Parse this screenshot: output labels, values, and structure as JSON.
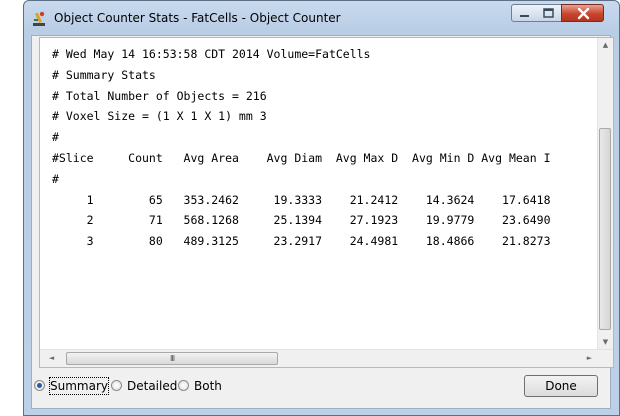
{
  "window": {
    "title": "Object Counter Stats - FatCells - Object Counter"
  },
  "icons": {
    "app": "imagej-microscope-icon",
    "minimize": "minimize-icon",
    "maximize": "maximize-icon",
    "close": "close-icon"
  },
  "stats_text": {
    "lines": [
      "# Wed May 14 16:53:58 CDT 2014 Volume=FatCells",
      "# Summary Stats",
      "# Total Number of Objects = 216",
      "# Voxel Size = (1 X 1 X 1) mm 3",
      "#",
      "#Slice     Count   Avg Area    Avg Diam  Avg Max D  Avg Min D Avg Mean I",
      "#",
      "     1        65   353.2462     19.3333    21.2412    14.3624    17.6418",
      "     2        71   568.1268     25.1394    27.1923    19.9779    23.6490",
      "     3        80   489.3125     23.2917    24.4981    18.4866    21.8273"
    ]
  },
  "scroll": {
    "grip": "III",
    "up_arrow": "▲",
    "down_arrow": "▼",
    "left_arrow": "◄",
    "right_arrow": "►"
  },
  "options": {
    "summary_label": "Summary",
    "detailed_label": "Detailed",
    "both_label": "Both",
    "selected": "Summary"
  },
  "buttons": {
    "done_label": "Done"
  },
  "colors": {
    "frame": "#b9cde5",
    "close_button": "#c8452e",
    "selected_radio": "#2a5d9e"
  }
}
